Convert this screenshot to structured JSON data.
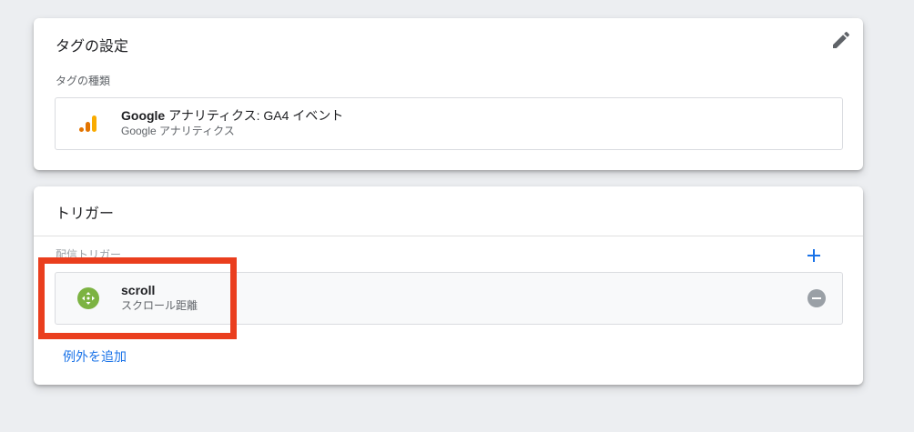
{
  "tag_config": {
    "title": "タグの設定",
    "section_label": "タグの種類",
    "tag_type": {
      "name_bold": "Google",
      "name_rest": " アナリティクス: GA4 イベント",
      "sub": "Google アナリティクス",
      "icon": "analytics-bars-icon"
    },
    "edit_icon": "pencil-icon"
  },
  "trigger": {
    "title": "トリガー",
    "section_label": "配信トリガー",
    "item": {
      "name": "scroll",
      "sub": "スクロール距離",
      "icon": "scroll-move-icon"
    },
    "add_icon": "plus-icon",
    "remove_icon": "minus-circle-icon",
    "add_exception_label": "例外を追加"
  },
  "colors": {
    "highlight": "#ea3e1e",
    "accent_blue": "#1a73e8",
    "analytics_orange": "#f9ab00",
    "analytics_dark_orange": "#e37400",
    "scroll_green": "#7cb342"
  }
}
